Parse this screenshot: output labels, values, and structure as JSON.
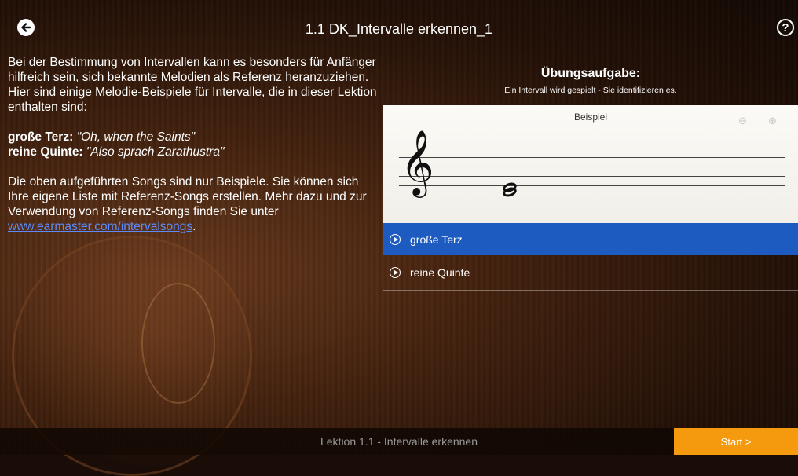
{
  "header": {
    "title": "1.1 DK_Intervalle erkennen_1",
    "back_icon": "arrow-left-circle-icon",
    "help_label": "?"
  },
  "lesson": {
    "paragraph1": "Bei der Bestimmung von Intervallen kann es besonders für Anfänger hilfreich sein, sich bekannte Melodien als Referenz heranzuziehen.",
    "paragraph2": "Hier sind einige Melodie-Beispiele für Intervalle, die in dieser Lektion enthalten sind:",
    "examples": [
      {
        "interval": "große Terz:",
        "song": "\"Oh, when the Saints\""
      },
      {
        "interval": "reine Quinte:",
        "song": "\"Also sprach Zarathustra\""
      }
    ],
    "paragraph3": "Die oben aufgeführten Songs sind nur Beispiele. Sie können sich Ihre eigene Liste mit Referenz-Songs erstellen. Mehr dazu und zur Verwendung von Referenz-Songs finden Sie unter",
    "link": "www.earmaster.com/intervalsongs",
    "link_suffix": "."
  },
  "exercise": {
    "title": "Übungsaufgabe:",
    "subtitle": "Ein Intervall wird gespielt - Sie identifizieren es.",
    "staff_label": "Beispiel",
    "clef": "𝄞"
  },
  "answers": [
    {
      "label": "große Terz",
      "selected": true
    },
    {
      "label": "reine Quinte",
      "selected": false
    }
  ],
  "footer": {
    "lesson_label": "Lektion 1.1 - Intervalle erkennen",
    "start_label": "Start >"
  },
  "colors": {
    "selected": "#1e5bc0",
    "start": "#f59a0e",
    "link": "#5b8bff"
  }
}
